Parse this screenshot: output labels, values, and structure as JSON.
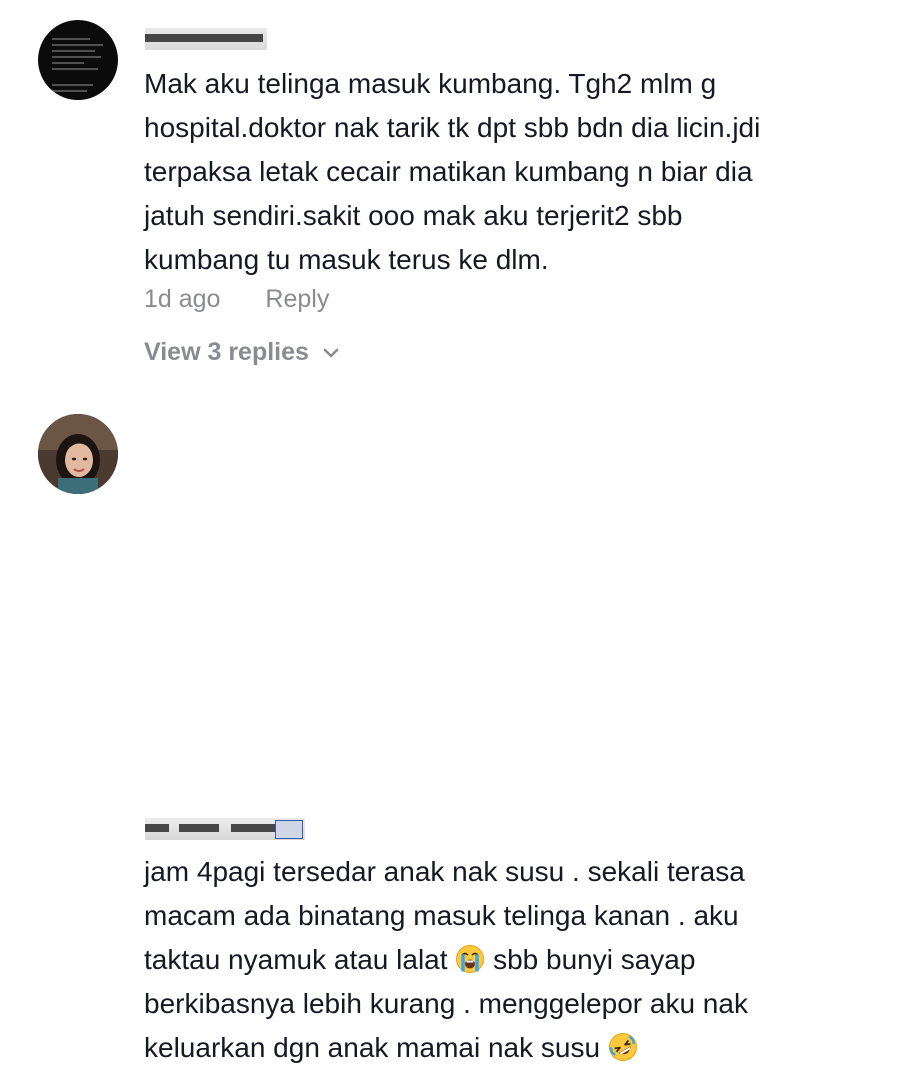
{
  "comments": [
    {
      "username": "",
      "text_lines": [
        "Mak aku telinga masuk kumbang. Tgh2 mlm g",
        "hospital.doktor nak tarik tk dpt sbb bdn dia licin.jdi",
        "terpaksa letak cecair matikan kumbang n biar dia",
        "jatuh sendiri.sakit ooo mak aku terjerit2 sbb",
        "kumbang tu masuk terus ke dlm."
      ],
      "time": "1d ago",
      "reply_label": "Reply",
      "view_replies_label": "View 3 replies"
    },
    {
      "username": "",
      "text_lines": [
        "jam 4pagi tersedar anak nak susu . sekali terasa",
        "macam ada binatang masuk telinga kanan . aku",
        "taktau nyamuk atau lalat",
        " sbb bunyi sayap",
        "berkibasnya lebih kurang . menggelepor aku nak",
        "keluarkan dgn anak mamai nak susu "
      ],
      "emojis": [
        "loudly-crying-face-icon",
        "rolling-on-floor-laughing-icon"
      ]
    }
  ],
  "colors": {
    "text": "#161823",
    "meta": "#8a8b91"
  }
}
